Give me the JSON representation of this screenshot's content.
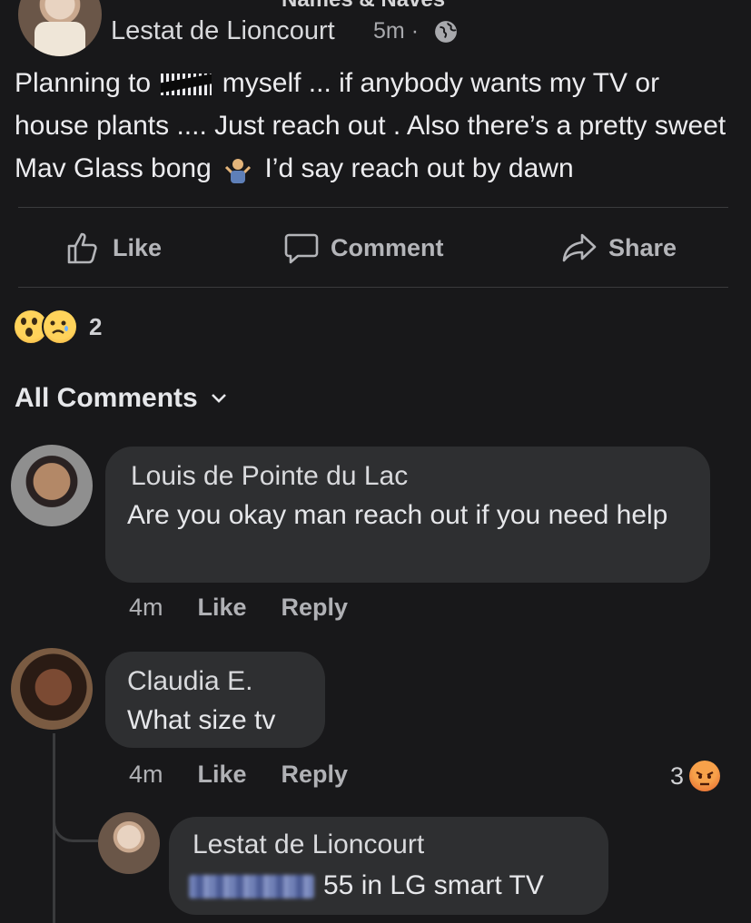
{
  "group": {
    "name": "Names & Naves"
  },
  "post": {
    "author": "Lestat de Lioncourt",
    "time": "5m",
    "separator": "·",
    "privacy_icon": "globe-icon",
    "text_part1": "Planning to ",
    "text_part2": " myself ... if anybody wants my TV or house plants .... Just reach out . Also there’s a pretty sweet Mav Glass bong ",
    "text_part3": " I’d say reach out by dawn"
  },
  "actions": {
    "like_label": "Like",
    "comment_label": "Comment",
    "share_label": "Share"
  },
  "reactions": {
    "types": [
      "wow",
      "sad"
    ],
    "count": "2"
  },
  "comments_filter": {
    "label": "All Comments"
  },
  "comments": [
    {
      "author": "Louis de Pointe du Lac",
      "text": "Are you okay man reach out if you need help",
      "time": "4m",
      "like_label": "Like",
      "reply_label": "Reply"
    },
    {
      "author": "Claudia E.",
      "text": "What size tv",
      "time": "4m",
      "like_label": "Like",
      "reply_label": "Reply",
      "reaction_count": "3",
      "reaction_type": "angry"
    }
  ],
  "reply": {
    "author": "Lestat de Lioncourt",
    "text": "55 in LG smart TV"
  },
  "colors": {
    "background": "#18181a",
    "bubble": "#2e2f31",
    "text": "#e4e6eb",
    "muted": "#b0b1b5"
  }
}
